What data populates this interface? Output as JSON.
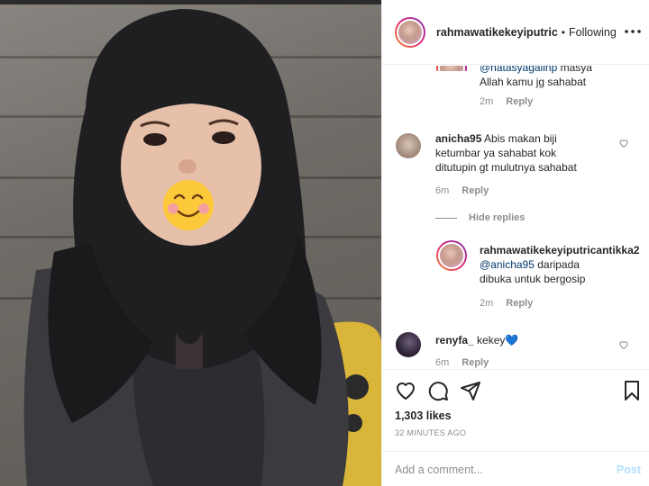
{
  "header": {
    "username": "rahmawatikekeyiputric",
    "separator": "•",
    "follow_status": "Following",
    "more_icon": "more-horizontal-icon"
  },
  "comments": [
    {
      "id": "reply-natasya",
      "mention": "@natasyagalinp",
      "text_a": " masya",
      "text_b": "Allah kamu jg sahabat",
      "time": "2m",
      "reply_label": "Reply"
    },
    {
      "id": "anicha95",
      "username": "anicha95",
      "text_a": " Abis makan biji",
      "text_b": "ketumbar ya sahabat kok",
      "text_c": "ditutupin gt mulutnya sahabat",
      "time": "6m",
      "reply_label": "Reply",
      "hide_replies_label": "Hide replies"
    },
    {
      "id": "reply-anicha",
      "username": "rahmawatikekeyiputricantikka2",
      "mention": "@anicha95",
      "text_a": " daripada",
      "text_b": "dibuka untuk bergosip",
      "time": "2m",
      "reply_label": "Reply"
    },
    {
      "id": "renyfa",
      "username": "renyfa_",
      "text_a": " kekey",
      "emoji": "💙",
      "time": "6m",
      "reply_label": "Reply"
    }
  ],
  "actions": {
    "likes": "1,303 likes",
    "time_ago": "32 MINUTES AGO",
    "comment_placeholder": "Add a comment...",
    "post_label": "Post",
    "icons": [
      "heart-icon",
      "comment-icon",
      "share-icon",
      "bookmark-icon"
    ]
  },
  "colors": {
    "link": "#00376b",
    "muted": "#8e8e8e",
    "post_disabled": "#b2dffc",
    "text": "#262626"
  },
  "photo": {
    "sticker": "smiling-face-emoji"
  }
}
